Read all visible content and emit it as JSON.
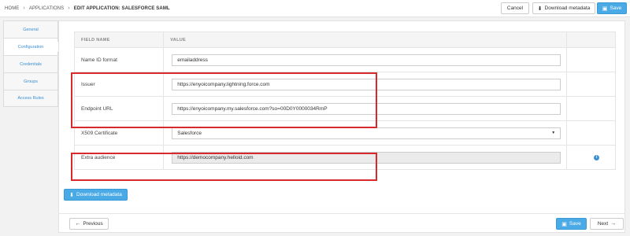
{
  "breadcrumb": {
    "home": "HOME",
    "applications": "APPLICATIONS",
    "current": "EDIT APPLICATION: SALESFORCE SAML"
  },
  "toolbar": {
    "cancel_label": "Cancel",
    "download_metadata_label": "Download metadata",
    "save_label": "Save"
  },
  "sidenav": {
    "items": [
      {
        "label": "General"
      },
      {
        "label": "Configuration"
      },
      {
        "label": "Credentials"
      },
      {
        "label": "Groups"
      },
      {
        "label": "Access Rules"
      }
    ]
  },
  "table": {
    "headers": {
      "field_name": "FIELD NAME",
      "value": "VALUE"
    },
    "rows": [
      {
        "name": "Name ID format",
        "value": "emailaddress"
      },
      {
        "name": "Issuer",
        "value": "https://enyoicompany.lightning.force.com"
      },
      {
        "name": "Endpoint URL",
        "value": "https://enyoicompany.my.salesforce.com?so=00D0Y0000034RmP"
      },
      {
        "name": "X509 Certificate",
        "value": "Salesforce"
      },
      {
        "name": "Extra audience",
        "value": "https://democompany.helloid.com"
      }
    ]
  },
  "footer": {
    "download_metadata_label": "Download metadata",
    "previous_label": "Previous",
    "save_label": "Save",
    "next_label": "Next"
  },
  "icons": {
    "download": "download-icon",
    "save": "save-icon",
    "info": "info-icon",
    "arrow_left": "arrow-left-icon",
    "arrow_right": "arrow-right-icon",
    "chevron": "chevron-right-icon",
    "caret": "caret-down-icon"
  },
  "colors": {
    "accent": "#4aaae6",
    "link": "#3a8fd0",
    "highlight": "#d82a2a"
  }
}
